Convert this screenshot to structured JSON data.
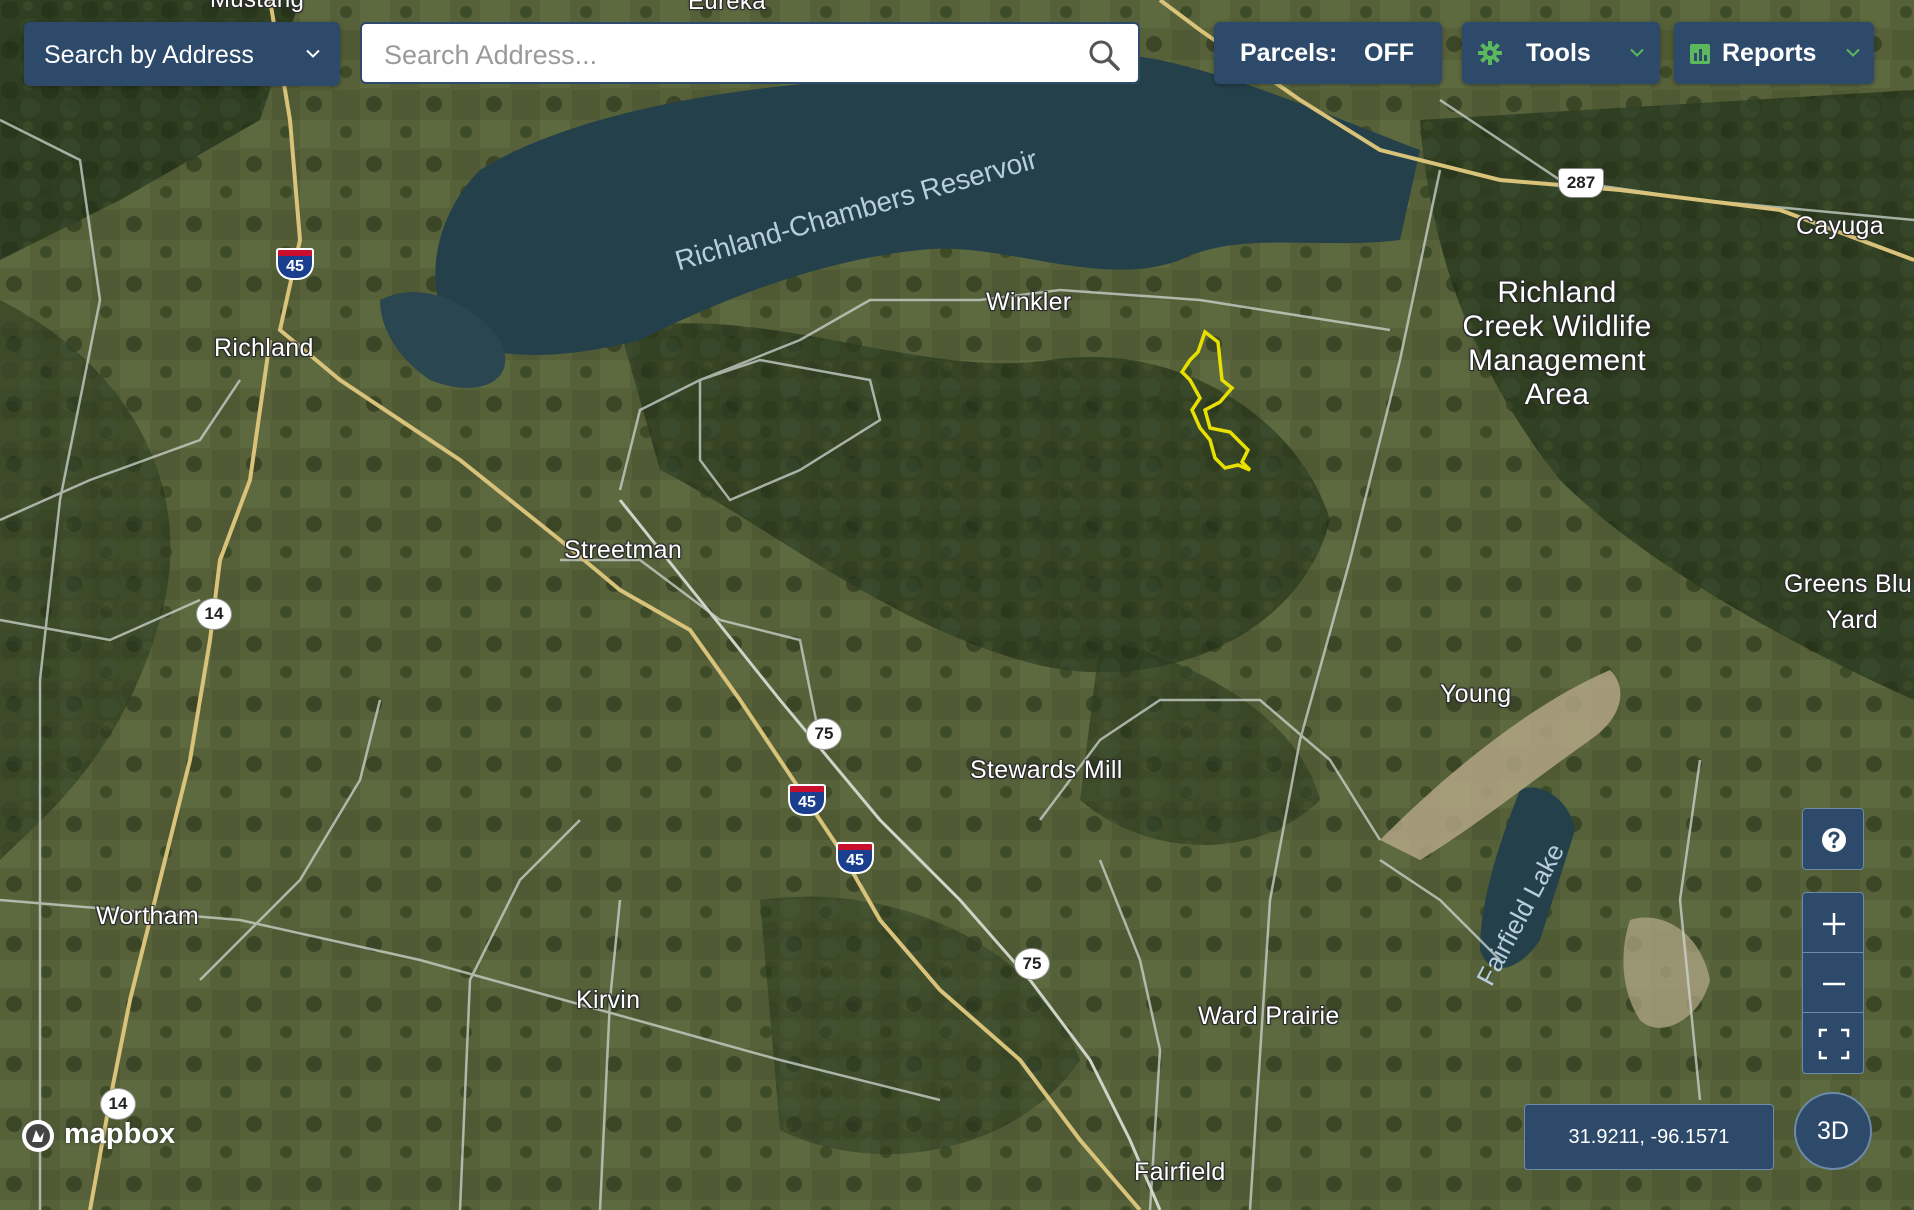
{
  "toolbar": {
    "search_mode_label": "Search by Address",
    "search_placeholder": "Search Address...",
    "search_value": "",
    "parcels_label": "Parcels:",
    "parcels_value": "OFF",
    "tools_label": "Tools",
    "reports_label": "Reports"
  },
  "map": {
    "basemap": "satellite",
    "places": {
      "mustang": "Mustang",
      "eureka": "Eureka",
      "richland": "Richland",
      "winkler": "Winkler",
      "cayuga": "Cayuga",
      "streetman": "Streetman",
      "young": "Young",
      "stewards_mill": "Stewards Mill",
      "wortham": "Wortham",
      "kirvin": "Kirvin",
      "ward_prairie": "Ward Prairie",
      "fairfield": "Fairfield",
      "greens_blu_line1": "Greens Blu",
      "greens_blu_line2": "Yard",
      "wildlife_line1": "Richland",
      "wildlife_line2": "Creek Wildlife",
      "wildlife_line3": "Management",
      "wildlife_line4": "Area"
    },
    "water": {
      "reservoir": "Richland-Chambers Reservoir",
      "lake": "Fairfield Lake"
    },
    "shields": {
      "i45_a": "45",
      "i45_b": "45",
      "i45_c": "45",
      "us287": "287",
      "sh14_a": "14",
      "sh14_b": "14",
      "sh75_a": "75",
      "sh75_b": "75"
    },
    "parcel_outline_color": "#e8e000",
    "road_color": "#d9c27a",
    "minor_road_color": "#cfd6d0",
    "water_color": "#24404a"
  },
  "controls": {
    "help_icon": "question-icon",
    "zoom_in_icon": "plus-icon",
    "zoom_out_icon": "minus-icon",
    "fullscreen_icon": "fullscreen-icon",
    "coordinates": "31.9211, -96.1571",
    "btn_3d": "3D",
    "attribution": "mapbox"
  },
  "colors": {
    "panel_bg": "#2d4a6b",
    "accent_green": "#5cb85c"
  }
}
